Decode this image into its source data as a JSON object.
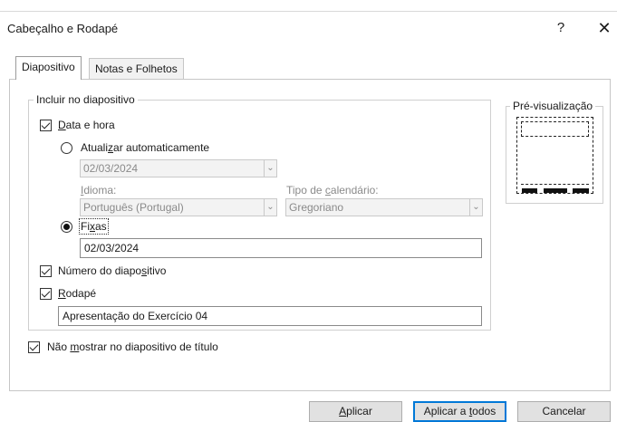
{
  "dialog": {
    "title": "Cabeçalho e Rodapé",
    "help_label": "?",
    "close_label": "✕"
  },
  "tabs": [
    {
      "label": "Diapositivo",
      "active": true
    },
    {
      "label": "Notas e Folhetos",
      "active": false
    }
  ],
  "include_group": {
    "legend": "Incluir no diapositivo",
    "date_time": {
      "label_underlined": "D",
      "label_rest": "ata e hora",
      "checked": true
    },
    "auto_update": {
      "label_pre": "Atuali",
      "label_underlined": "z",
      "label_post": "ar automaticamente",
      "selected": false,
      "date_value": "02/03/2024"
    },
    "language": {
      "label_underlined": "I",
      "label_rest": "dioma:",
      "value": "Português (Portugal)"
    },
    "calendar": {
      "label_pre": "Tipo de ",
      "label_underlined": "c",
      "label_post": "alendário:",
      "value": "Gregoriano"
    },
    "fixed": {
      "label_pre": "Fi",
      "label_underlined": "x",
      "label_post": "as",
      "selected": true,
      "value": "02/03/2024"
    },
    "slide_number": {
      "label_pre": "Número do diapo",
      "label_underlined": "s",
      "label_post": "itivo",
      "checked": true
    },
    "footer": {
      "label_underlined": "R",
      "label_rest": "odapé",
      "checked": true,
      "value": "Apresentação do Exercício 04"
    }
  },
  "dont_show_title": {
    "label_pre": "Não ",
    "label_underlined": "m",
    "label_post": "ostrar no diapositivo de título",
    "checked": true
  },
  "preview": {
    "legend": "Pré-visualização"
  },
  "buttons": {
    "apply": {
      "label_underlined": "A",
      "label_rest": "plicar"
    },
    "apply_all": {
      "label_pre": "Aplicar a ",
      "label_underlined": "t",
      "label_post": "odos"
    },
    "cancel": {
      "label": "Cancelar"
    }
  },
  "colors": {
    "accent": "#0078d7",
    "disabled_text": "#8a8a8a"
  }
}
